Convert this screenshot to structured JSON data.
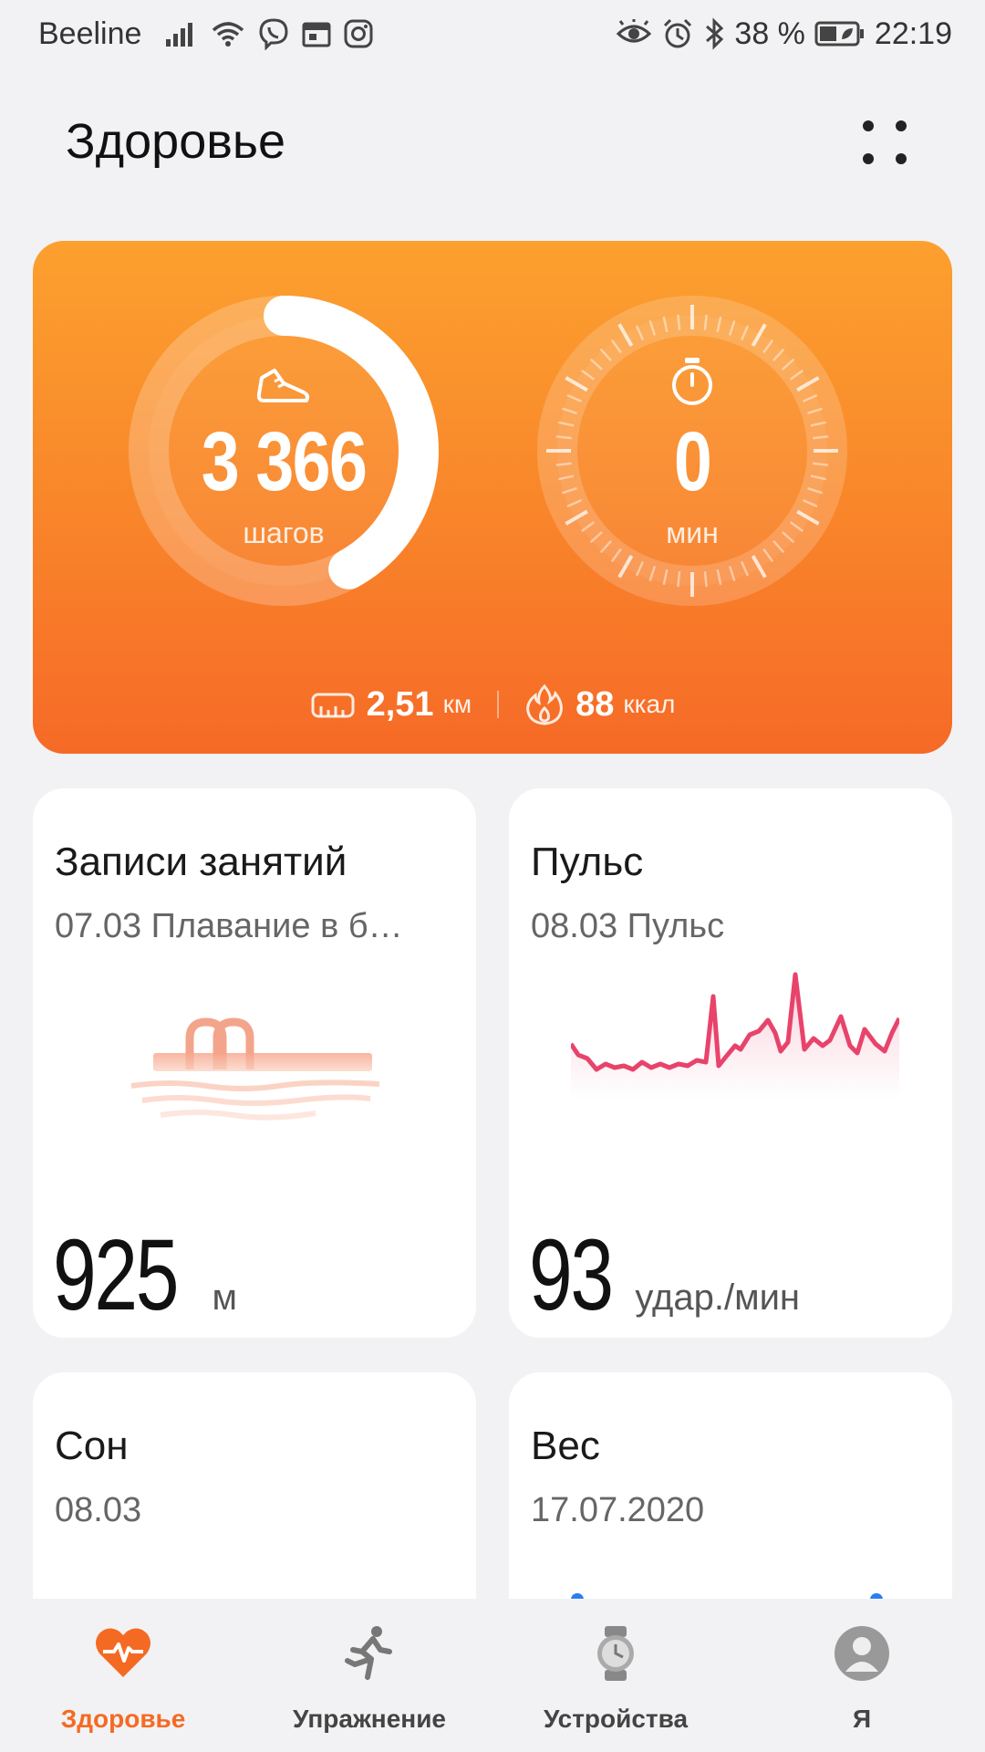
{
  "status_bar": {
    "carrier": "Beeline",
    "battery": "38 %",
    "time": "22:19",
    "icons": [
      "signal-icon",
      "wifi-icon",
      "viber-icon",
      "calendar-icon",
      "instagram-icon",
      "eye-icon",
      "alarm-icon",
      "bluetooth-icon",
      "battery-icon"
    ]
  },
  "header": {
    "title": "Здоровье",
    "menu_icon": "grid-dots-icon"
  },
  "hero": {
    "steps": {
      "value": "3 366",
      "unit": "шагов",
      "icon": "sneaker-icon",
      "progress": 0.42
    },
    "minutes": {
      "value": "0",
      "unit": "мин",
      "icon": "stopwatch-icon",
      "progress": 0
    },
    "distance": {
      "value": "2,51",
      "unit": "км",
      "icon": "ruler-icon"
    },
    "calories": {
      "value": "88",
      "unit": "ккал",
      "icon": "flame-icon"
    },
    "colors": {
      "top": "#fca02f",
      "bottom": "#f66a27"
    }
  },
  "cards": {
    "activity": {
      "title": "Записи занятий",
      "subtitle": "07.03 Плавание в б…",
      "value": "925",
      "unit": "м",
      "icon": "pool-icon"
    },
    "pulse": {
      "title": "Пульс",
      "subtitle": "08.03 Пульс",
      "value": "93",
      "unit": "удар./мин",
      "chart_color": "#e8436b"
    },
    "sleep": {
      "title": "Сон",
      "subtitle": "08.03"
    },
    "weight": {
      "title": "Вес",
      "subtitle": "17.07.2020"
    }
  },
  "nav": {
    "items": [
      {
        "label": "Здоровье",
        "icon": "heart-pulse-icon",
        "active": true
      },
      {
        "label": "Упражнение",
        "icon": "runner-icon",
        "active": false
      },
      {
        "label": "Устройства",
        "icon": "watch-icon",
        "active": false
      },
      {
        "label": "Я",
        "icon": "profile-icon",
        "active": false
      }
    ],
    "accent": "#f56a23"
  }
}
